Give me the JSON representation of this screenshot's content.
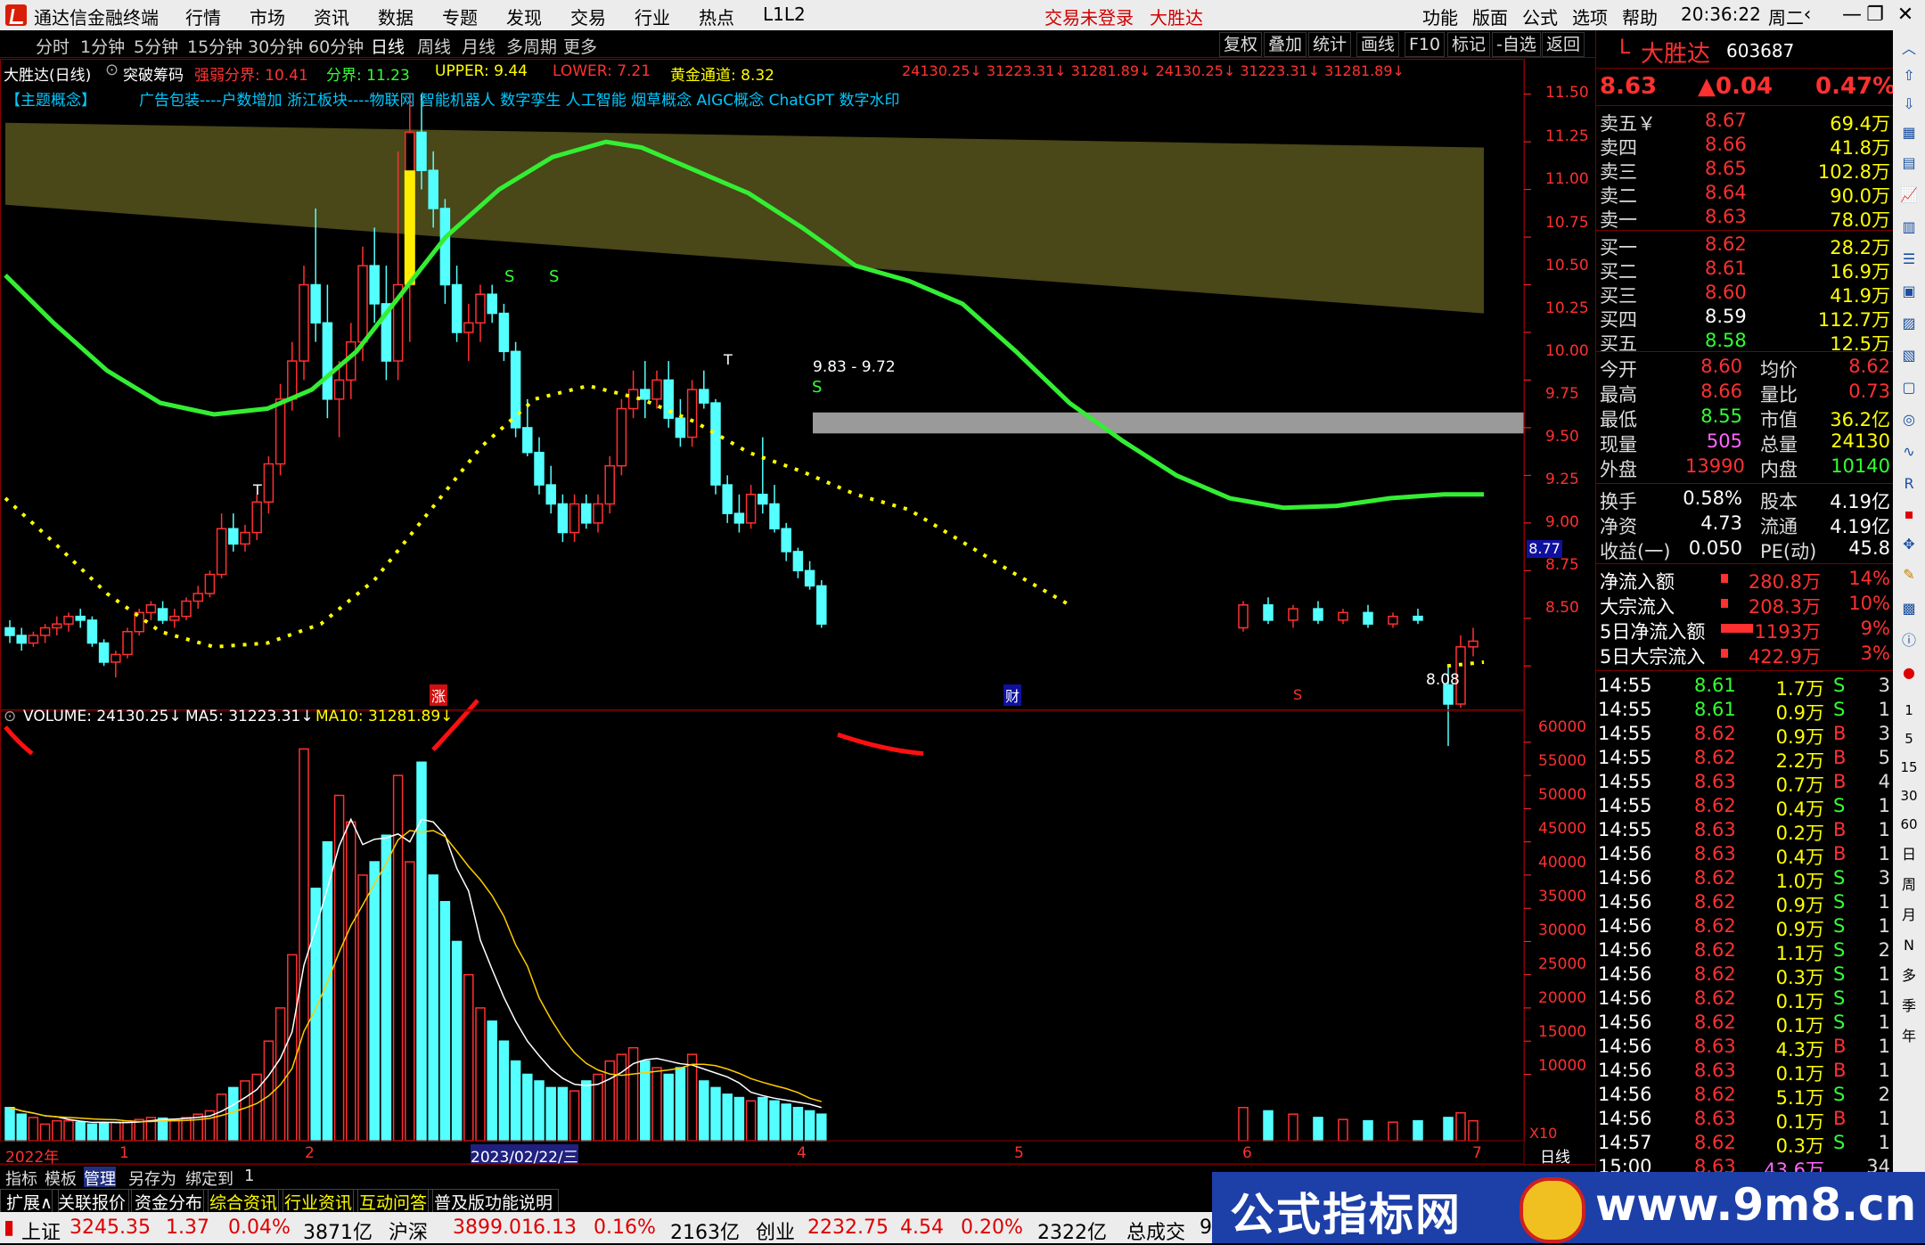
{
  "menubar": {
    "app_title": "通达信金融终端",
    "menus": [
      "行情",
      "市场",
      "资讯",
      "数据",
      "专题",
      "发现",
      "交易",
      "行业",
      "热点",
      "L1L2"
    ],
    "login_status": "交易未登录",
    "broker": "大胜达",
    "right_menus": [
      "功能",
      "版面",
      "公式",
      "选项",
      "帮助"
    ],
    "time": "20:36:22",
    "weekday": "周二"
  },
  "periodbar": {
    "periods": [
      "分时",
      "1分钟",
      "5分钟",
      "15分钟",
      "30分钟",
      "60分钟",
      "日线",
      "周线",
      "月线",
      "多周期",
      "更多"
    ],
    "active": "日线",
    "tools": [
      "复权",
      "叠加",
      "统计",
      "画线",
      "F10",
      "标记",
      "-自选",
      "返回"
    ]
  },
  "main_header": {
    "stock_name": "大胜达(日线)",
    "indicator": "突破筹码",
    "strong_weak_label": "强弱分界: 10.41",
    "boundary_label": "分界: 11.23",
    "upper_label": "UPPER: 9.44",
    "lower_label": "LOWER: 7.21",
    "gold_label": "黄金通道: 8.32",
    "vol_vals": "24130.25↓ 31223.31↓ 31281.89↓ 24130.25↓ 31223.31↓ 31281.89↓",
    "concept_tag": "【主题概念】",
    "concepts": "广告包装----户数增加 浙江板块----物联网 智能机器人 数字孪生 人工智能 烟草概念 AIGC概念 ChatGPT 数字水印"
  },
  "price_axis": [
    "11.50",
    "11.25",
    "11.00",
    "10.75",
    "10.50",
    "10.25",
    "10.00",
    "9.75",
    "9.50",
    "9.25",
    "9.00",
    "8.75",
    "8.50"
  ],
  "price_marker": "8.77",
  "zone_label": "9.83 - 9.72",
  "low_label": "8.08",
  "chart_marks": {
    "zhang": "涨",
    "cai": "财",
    "s_mark": "S",
    "t_mark": "T"
  },
  "volume_header": {
    "volume": "VOLUME: 24130.25↓",
    "ma5": "MA5: 31223.31↓",
    "ma10": "MA10: 31281.89↓"
  },
  "volume_axis": [
    "60000",
    "55000",
    "50000",
    "45000",
    "40000",
    "35000",
    "30000",
    "25000",
    "20000",
    "15000",
    "10000"
  ],
  "volume_unit": "X10",
  "date_axis": {
    "labels": [
      "2022年",
      "1",
      "2",
      "2023/02/22/三",
      "4",
      "5",
      "6",
      "7"
    ],
    "period": "日线"
  },
  "chart_data": {
    "type": "candlestick",
    "note_ylim": [
      8.3,
      11.6
    ],
    "candles": [
      [
        8.7,
        8.74,
        8.62,
        8.66
      ],
      [
        8.66,
        8.7,
        8.58,
        8.62
      ],
      [
        8.62,
        8.68,
        8.6,
        8.66
      ],
      [
        8.66,
        8.72,
        8.62,
        8.7
      ],
      [
        8.7,
        8.76,
        8.66,
        8.72
      ],
      [
        8.72,
        8.78,
        8.68,
        8.76
      ],
      [
        8.76,
        8.8,
        8.7,
        8.74
      ],
      [
        8.74,
        8.76,
        8.6,
        8.62
      ],
      [
        8.62,
        8.64,
        8.5,
        8.52
      ],
      [
        8.52,
        8.58,
        8.44,
        8.56
      ],
      [
        8.56,
        8.7,
        8.54,
        8.68
      ],
      [
        8.68,
        8.8,
        8.66,
        8.78
      ],
      [
        8.78,
        8.84,
        8.74,
        8.82
      ],
      [
        8.8,
        8.84,
        8.72,
        8.74
      ],
      [
        8.74,
        8.8,
        8.7,
        8.76
      ],
      [
        8.76,
        8.86,
        8.74,
        8.84
      ],
      [
        8.84,
        8.92,
        8.8,
        8.88
      ],
      [
        8.88,
        9.0,
        8.86,
        8.98
      ],
      [
        8.98,
        9.3,
        8.96,
        9.22
      ],
      [
        9.22,
        9.3,
        9.1,
        9.14
      ],
      [
        9.14,
        9.24,
        9.1,
        9.2
      ],
      [
        9.2,
        9.4,
        9.16,
        9.36
      ],
      [
        9.36,
        9.6,
        9.3,
        9.56
      ],
      [
        9.56,
        9.98,
        9.5,
        9.9
      ],
      [
        9.9,
        10.2,
        9.84,
        10.1
      ],
      [
        10.1,
        10.6,
        10.0,
        10.5
      ],
      [
        10.5,
        10.9,
        10.2,
        10.3
      ],
      [
        10.3,
        10.5,
        9.8,
        9.9
      ],
      [
        9.9,
        10.1,
        9.7,
        10.0
      ],
      [
        10.0,
        10.3,
        9.9,
        10.2
      ],
      [
        10.2,
        10.7,
        10.1,
        10.6
      ],
      [
        10.6,
        10.8,
        10.3,
        10.4
      ],
      [
        10.4,
        10.6,
        10.0,
        10.1
      ],
      [
        10.1,
        11.2,
        10.0,
        10.5
      ],
      [
        10.5,
        11.5,
        10.2,
        11.3
      ],
      [
        11.3,
        11.5,
        11.0,
        11.1
      ],
      [
        11.1,
        11.2,
        10.8,
        10.9
      ],
      [
        10.9,
        10.95,
        10.4,
        10.5
      ],
      [
        10.5,
        10.6,
        10.2,
        10.25
      ],
      [
        10.25,
        10.4,
        10.1,
        10.3
      ],
      [
        10.3,
        10.5,
        10.2,
        10.45
      ],
      [
        10.45,
        10.5,
        10.3,
        10.35
      ],
      [
        10.35,
        10.4,
        10.1,
        10.15
      ],
      [
        10.15,
        10.2,
        9.7,
        9.75
      ],
      [
        9.75,
        9.9,
        9.6,
        9.62
      ],
      [
        9.62,
        9.7,
        9.4,
        9.45
      ],
      [
        9.45,
        9.55,
        9.3,
        9.35
      ],
      [
        9.35,
        9.4,
        9.15,
        9.2
      ],
      [
        9.2,
        9.4,
        9.15,
        9.35
      ],
      [
        9.35,
        9.4,
        9.22,
        9.25
      ],
      [
        9.25,
        9.4,
        9.2,
        9.35
      ],
      [
        9.35,
        9.6,
        9.3,
        9.55
      ],
      [
        9.55,
        9.9,
        9.5,
        9.85
      ],
      [
        9.85,
        10.05,
        9.8,
        9.95
      ],
      [
        9.95,
        10.1,
        9.8,
        9.9
      ],
      [
        9.9,
        10.05,
        9.85,
        10.0
      ],
      [
        10.0,
        10.1,
        9.75,
        9.8
      ],
      [
        9.8,
        9.9,
        9.65,
        9.7
      ],
      [
        9.7,
        10.0,
        9.65,
        9.95
      ],
      [
        9.95,
        10.05,
        9.85,
        9.88
      ],
      [
        9.88,
        9.9,
        9.4,
        9.45
      ],
      [
        9.45,
        9.5,
        9.25,
        9.3
      ],
      [
        9.3,
        9.4,
        9.2,
        9.25
      ],
      [
        9.25,
        9.45,
        9.22,
        9.4
      ],
      [
        9.4,
        9.7,
        9.3,
        9.35
      ],
      [
        9.35,
        9.45,
        9.2,
        9.22
      ],
      [
        9.22,
        9.25,
        9.05,
        9.1
      ],
      [
        9.1,
        9.12,
        8.96,
        9.0
      ],
      [
        9.0,
        9.05,
        8.9,
        8.92
      ],
      [
        8.92,
        8.95,
        8.7,
        8.72
      ]
    ],
    "tail_candles": [
      [
        8.7,
        8.84,
        8.68,
        8.82
      ],
      [
        8.82,
        8.86,
        8.72,
        8.74
      ],
      [
        8.74,
        8.82,
        8.7,
        8.8
      ],
      [
        8.8,
        8.84,
        8.72,
        8.74
      ],
      [
        8.74,
        8.8,
        8.72,
        8.78
      ],
      [
        8.78,
        8.82,
        8.7,
        8.72
      ],
      [
        8.72,
        8.78,
        8.7,
        8.76
      ],
      [
        8.76,
        8.8,
        8.72,
        8.74
      ],
      [
        8.4,
        8.5,
        8.08,
        8.3
      ],
      [
        8.3,
        8.66,
        8.28,
        8.6
      ],
      [
        8.6,
        8.7,
        8.55,
        8.63
      ]
    ],
    "volume_ma_note": "MA5 white, MA10 yellow"
  },
  "quote_panel": {
    "market_flag": "L",
    "name": "大胜达",
    "code": "603687",
    "price": "8.63",
    "change": "▲0.04",
    "change_pct": "0.47%",
    "asks": [
      {
        "label": "卖五￥",
        "price": "8.67",
        "vol": "69.4万"
      },
      {
        "label": "卖四",
        "price": "8.66",
        "vol": "41.8万"
      },
      {
        "label": "卖三",
        "price": "8.65",
        "vol": "102.8万"
      },
      {
        "label": "卖二",
        "price": "8.64",
        "vol": "90.0万"
      },
      {
        "label": "卖一",
        "price": "8.63",
        "vol": "78.0万"
      }
    ],
    "bids": [
      {
        "label": "买一",
        "price": "8.62",
        "vol": "28.2万"
      },
      {
        "label": "买二",
        "price": "8.61",
        "vol": "16.9万"
      },
      {
        "label": "买三",
        "price": "8.60",
        "vol": "41.9万"
      },
      {
        "label": "买四",
        "price": "8.59",
        "vol": "112.7万"
      },
      {
        "label": "买五",
        "price": "8.58",
        "vol": "12.5万"
      }
    ],
    "stats": [
      {
        "l1": "今开",
        "v1": "8.60",
        "l2": "均价",
        "v2": "8.62"
      },
      {
        "l1": "最高",
        "v1": "8.66",
        "l2": "量比",
        "v2": "0.73"
      },
      {
        "l1": "最低",
        "v1": "8.55",
        "l2": "市值",
        "v2": "36.2亿"
      },
      {
        "l1": "现量",
        "v1": "505",
        "l2": "总量",
        "v2": "24130"
      },
      {
        "l1": "外盘",
        "v1": "13990",
        "l2": "内盘",
        "v2": "10140"
      }
    ],
    "fund": [
      {
        "l1": "换手",
        "v1": "0.58%",
        "l2": "股本",
        "v2": "4.19亿"
      },
      {
        "l1": "净资",
        "v1": "4.73",
        "l2": "流通",
        "v2": "4.19亿"
      },
      {
        "l1": "收益(一)",
        "v1": "0.050",
        "l2": "PE(动)",
        "v2": "45.8"
      }
    ],
    "flows": [
      {
        "label": "净流入额",
        "value": "280.8万",
        "pct": "14%"
      },
      {
        "label": "大宗流入",
        "value": "208.3万",
        "pct": "10%"
      },
      {
        "label": "5日净流入额",
        "value": "1193万",
        "pct": "9%"
      },
      {
        "label": "5日大宗流入",
        "value": "422.9万",
        "pct": "3%"
      }
    ],
    "ticks": [
      [
        "14:55",
        "8.61",
        "1.7万",
        "S",
        "3"
      ],
      [
        "14:55",
        "8.61",
        "0.9万",
        "S",
        "1"
      ],
      [
        "14:55",
        "8.62",
        "0.9万",
        "B",
        "3"
      ],
      [
        "14:55",
        "8.62",
        "2.2万",
        "B",
        "5"
      ],
      [
        "14:55",
        "8.63",
        "0.7万",
        "B",
        "4"
      ],
      [
        "14:55",
        "8.62",
        "0.4万",
        "S",
        "1"
      ],
      [
        "14:55",
        "8.63",
        "0.2万",
        "B",
        "1"
      ],
      [
        "14:56",
        "8.63",
        "0.4万",
        "B",
        "1"
      ],
      [
        "14:56",
        "8.62",
        "1.0万",
        "S",
        "3"
      ],
      [
        "14:56",
        "8.62",
        "0.9万",
        "S",
        "1"
      ],
      [
        "14:56",
        "8.62",
        "0.9万",
        "S",
        "1"
      ],
      [
        "14:56",
        "8.62",
        "1.1万",
        "S",
        "2"
      ],
      [
        "14:56",
        "8.62",
        "0.3万",
        "S",
        "1"
      ],
      [
        "14:56",
        "8.62",
        "0.1万",
        "S",
        "1"
      ],
      [
        "14:56",
        "8.62",
        "0.1万",
        "S",
        "1"
      ],
      [
        "14:56",
        "8.63",
        "4.3万",
        "B",
        "1"
      ],
      [
        "14:56",
        "8.63",
        "0.1万",
        "B",
        "1"
      ],
      [
        "14:56",
        "8.62",
        "5.1万",
        "S",
        "2"
      ],
      [
        "14:56",
        "8.63",
        "0.1万",
        "B",
        "1"
      ],
      [
        "14:57",
        "8.62",
        "0.3万",
        "S",
        "1"
      ],
      [
        "15:00",
        "8.63",
        "43.6万",
        "",
        "34"
      ]
    ]
  },
  "side_tabs": [
    "日",
    "周",
    "月",
    "N",
    "多",
    "季",
    "年"
  ],
  "side_nums": [
    "1",
    "5",
    "15",
    "30",
    "60"
  ],
  "bottom_tabs": [
    "指标",
    "模板",
    "管理",
    "另存为",
    "绑定到",
    "1"
  ],
  "bottom_tabs2": [
    "扩展∧",
    "关联报价",
    "资金分布",
    "综合资讯",
    "行业资讯",
    "互动问答",
    "普及版功能说明"
  ],
  "status": {
    "sh_label": "上证",
    "sh": "3245.35",
    "sh_chg": "1.37",
    "sh_pct": "0.04%",
    "sh_amt": "3871亿",
    "hs_label": "沪深",
    "hs": "3899.01",
    "hs_chg": "6.13",
    "hs_pct": "0.16%",
    "hs_amt": "2163亿",
    "cy_label": "创业",
    "cy": "2232.75",
    "cy_chg": "4.54",
    "cy_pct": "0.20%",
    "cy_amt": "2322亿",
    "total_label": "总成交",
    "total": "9"
  },
  "watermark": {
    "text": "公式指标网",
    "url": "www.9m8.cn"
  }
}
